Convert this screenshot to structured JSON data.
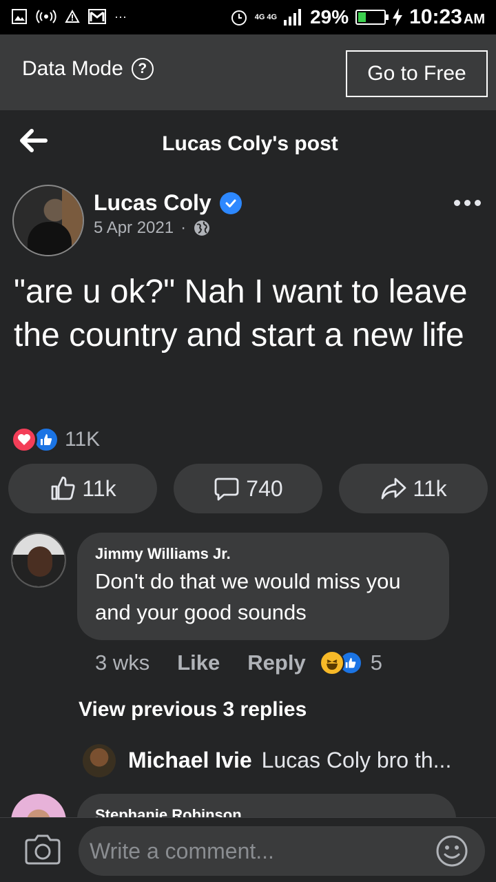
{
  "status_bar": {
    "network": "4G 4G",
    "battery_pct": "29%",
    "battery_level": 0.29,
    "time": "10:23",
    "ampm": "AM"
  },
  "data_mode": {
    "label": "Data Mode",
    "go_free": "Go to Free"
  },
  "header": {
    "title": "Lucas Coly's post"
  },
  "post": {
    "author": "Lucas Coly",
    "date": "5 Apr 2021",
    "separator": "·",
    "text": "\"are u ok?\" Nah I want to leave the country and start a new life",
    "reaction_count": "11K",
    "likes": "11k",
    "comments": "740",
    "shares": "11k"
  },
  "comment": {
    "author": "Jimmy Williams Jr.",
    "text": "Don't do that we would miss you and your good sounds",
    "time": "3 wks",
    "like_label": "Like",
    "reply_label": "Reply",
    "reaction_count": "5",
    "view_previous": "View previous 3 replies",
    "reply": {
      "author": "Michael Ivie",
      "text": "Lucas Coly bro th..."
    }
  },
  "next_comment": {
    "author": "Stephanie Robinson"
  },
  "composer": {
    "placeholder": "Write a comment..."
  },
  "colors": {
    "background": "#242526",
    "bubble": "#3a3b3c",
    "accent": "#1b74e4",
    "love": "#f33e58",
    "haha": "#f7b928"
  }
}
